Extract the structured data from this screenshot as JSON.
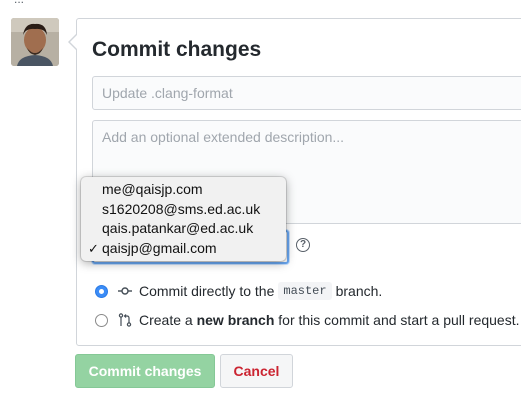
{
  "header": {
    "cutoff_text": "..."
  },
  "avatar": {
    "alt": "user avatar"
  },
  "commit": {
    "title": "Commit changes",
    "summary_placeholder": "Update .clang-format",
    "summary_value": "",
    "description_placeholder": "Add an optional extended description...",
    "description_value": ""
  },
  "email_dropdown": {
    "options": [
      {
        "label": "me@qaisjp.com",
        "selected": false
      },
      {
        "label": "s1620208@sms.ed.ac.uk",
        "selected": false
      },
      {
        "label": "qais.patankar@ed.ac.uk",
        "selected": false
      },
      {
        "label": "qaisjp@gmail.com",
        "selected": true
      }
    ],
    "check_mark": "✓",
    "help_glyph": "?"
  },
  "options": {
    "direct": {
      "prefix": "Commit directly to the",
      "branch": "master",
      "suffix": "branch.",
      "checked": true,
      "icon": "git-commit-icon"
    },
    "new_branch": {
      "prefix": "Create a",
      "bold": "new branch",
      "suffix": "for this commit and start a pull request.",
      "checked": false,
      "icon": "git-pull-request-icon"
    }
  },
  "buttons": {
    "commit_label": "Commit changes",
    "cancel_label": "Cancel"
  },
  "colors": {
    "commit_button": "#94d3a2",
    "cancel_text": "#cb2431",
    "radio_checked": "#3b8cf7",
    "focus_ring": "#6aa9f4"
  }
}
